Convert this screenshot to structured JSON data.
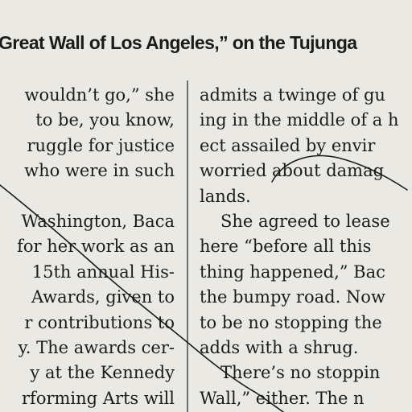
{
  "headline": "Great Wall of Los Angeles,” on the Tujunga",
  "left_column": [
    {
      "text": "wouldn’t go,” she",
      "indent": false
    },
    {
      "text": "to be, you know,",
      "indent": false
    },
    {
      "text": "ruggle for justice",
      "indent": false
    },
    {
      "text": "who were in such",
      "indent": false
    },
    {
      "text": "",
      "indent": false
    },
    {
      "text": "Washington, Baca",
      "indent": false
    },
    {
      "text": "for her work as an",
      "indent": false
    },
    {
      "text": "15th annual His-",
      "indent": false
    },
    {
      "text": "Awards, given to",
      "indent": false
    },
    {
      "text": "r contributions to",
      "indent": false
    },
    {
      "text": "y. The awards cer-",
      "indent": false
    },
    {
      "text": "y at the Kennedy",
      "indent": false
    },
    {
      "text": "rforming Arts will",
      "indent": false
    }
  ],
  "right_column": [
    {
      "text": "admits a twinge of gu",
      "indent": false
    },
    {
      "text": "ing in the middle of a h",
      "indent": false
    },
    {
      "text": "ect assailed by envir",
      "indent": false
    },
    {
      "text": "worried about damag",
      "indent": false
    },
    {
      "text": "lands.",
      "indent": false
    },
    {
      "text": "She agreed to lease",
      "indent": true
    },
    {
      "text": "here “before all this",
      "indent": false
    },
    {
      "text": "thing happened,” Bac",
      "indent": false
    },
    {
      "text": "the bumpy road. Now",
      "indent": false
    },
    {
      "text": "to be no stopping the",
      "indent": false
    },
    {
      "text": "adds with a shrug.",
      "indent": false
    },
    {
      "text": "There’s no stoppin",
      "indent": true
    },
    {
      "text": "Wall,” either. The n",
      "indent": false
    }
  ],
  "colors": {
    "paper": "#ebe9e4",
    "ink": "#1c1c1c",
    "pen_mark": "#1a1a1a"
  }
}
